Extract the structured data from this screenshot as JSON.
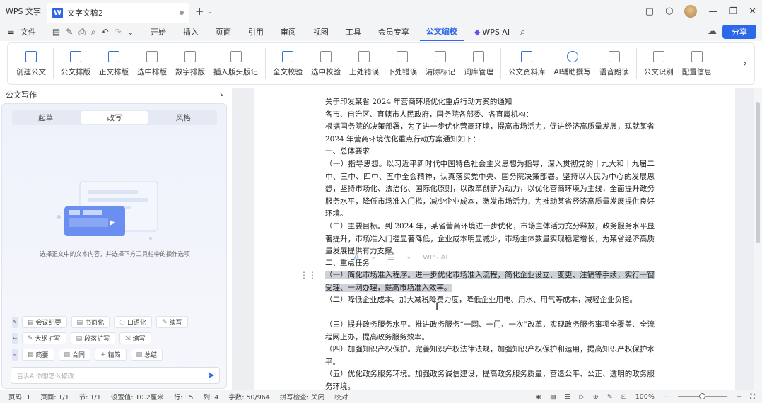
{
  "titlebar": {
    "app_name": "WPS 文字",
    "doc_tab": "文字文稿2",
    "new_tab": "+",
    "dropdown": "⌄"
  },
  "menu": {
    "file": "文件",
    "items": [
      "开始",
      "插入",
      "页面",
      "引用",
      "审阅",
      "视图",
      "工具",
      "会员专享",
      "公文编校",
      "WPS AI"
    ],
    "active": "公文编校",
    "share": "分享"
  },
  "ribbon": {
    "buttons": [
      "创建公文",
      "公文排版",
      "正文排版",
      "选中排版",
      "数字排版",
      "插入版头版记",
      "全文校验",
      "选中校验",
      "上处错误",
      "下处错误",
      "清除标记",
      "词库管理",
      "公文资料库",
      "AI辅助撰写",
      "语音朗读",
      "公文识别",
      "配置信息"
    ]
  },
  "left_panel": {
    "title": "公文写作",
    "tabs": [
      "起草",
      "改写",
      "风格"
    ],
    "active_tab": "改写",
    "hint": "选择正文中的文本内容，并选择下方工具栏中的操作选项",
    "chips_row1": [
      "会议纪要",
      "书面化",
      "口语化",
      "续写"
    ],
    "chips_row2": [
      "大纲扩写",
      "段落扩写",
      "缩写"
    ],
    "chips_row3": [
      "简要",
      "合同",
      "精简",
      "总结"
    ],
    "input_placeholder": "告诉AI你想怎么修改"
  },
  "document": {
    "paragraphs": [
      "关于印发某省 2024 年营商环境优化重点行动方案的通知",
      "各市、自治区、直辖市人民政府，国务院各部委、各直属机构：",
      "根据国务院的决策部署，为了进一步优化营商环境，提高市场活力，促进经济高质量发展，现就某省 2024 年营商环境优化重点行动方案通知如下：",
      "一、总体要求",
      "（一）指导思想。以习近平新时代中国特色社会主义思想为指导，深入贯彻党的十九大和十九届二中、三中、四中、五中全会精神，认真落实党中央、国务院决策部署。坚持以人民为中心的发展思想，坚持市场化、法治化、国际化原则，以改革创新为动力，以优化营商环境为主线，全面提升政务服务水平，降低市场准入门槛，减少企业成本，激发市场活力，为推动某省经济高质量发展提供良好环境。",
      "（二）主要目标。到 2024 年，某省营商环境进一步优化，市场主体活力充分释放，政务服务水平显著提升，市场准入门槛显著降低，企业成本明显减少，市场主体数量实现稳定增长，为某省经济高质量发展提供有力支撑。",
      "二、重点任务",
      "（一）简化市场准入程序。进一步优化市场准入流程，简化企业设立、变更、注销等手续，实行一窗受理、一网办理，提高市场准入效率。",
      "（二）降低企业成本。加大减税降费力度，降低企业用电、用水、用气等成本，减轻企业负担。",
      "（三）提升政务服务水平。推进政务服务“一网、一门、一次”改革，实现政务服务事项全覆盖、全流程网上办，提高政务服务效率。",
      "（四）加强知识产权保护。完善知识产权法律法规，加强知识产权保护和运用，提高知识产权保护水平。",
      "（五）优化政务服务环境。加强政务诚信建设，提高政务服务质量，营造公平、公正、透明的政务服务环境。"
    ],
    "highlighted_index": 7,
    "mini_toolbar": {
      "ai_label": "WPS AI"
    }
  },
  "statusbar": {
    "page": "页码: 1",
    "pages": "页面: 1/1",
    "section": "节: 1/1",
    "setting": "设置值: 10.2厘米",
    "row": "行: 15",
    "col": "列: 4",
    "words": "字数: 50/964",
    "spell": "拼写检查: 关闭",
    "proof": "校对",
    "zoom": "100%"
  }
}
